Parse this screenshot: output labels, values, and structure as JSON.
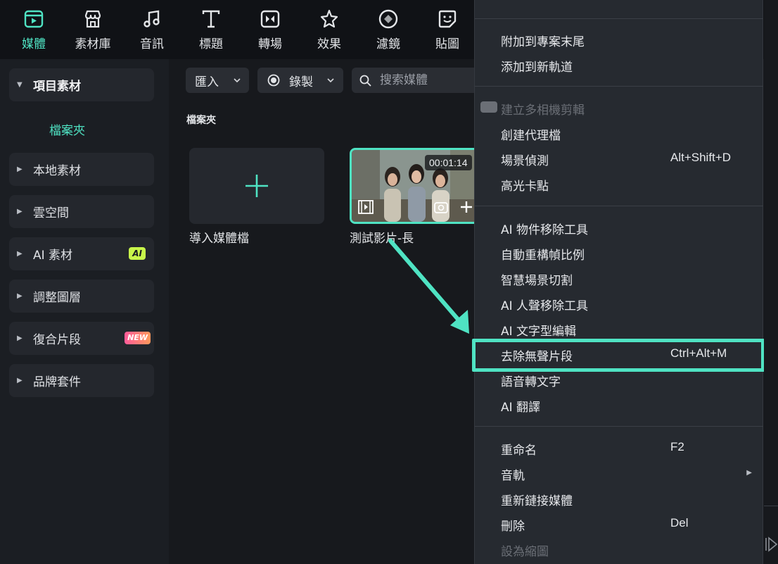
{
  "toolbar": {
    "tabs": [
      {
        "label": "媒體",
        "icon": "media-icon",
        "active": true
      },
      {
        "label": "素材庫",
        "icon": "store-icon"
      },
      {
        "label": "音訊",
        "icon": "music-note-icon"
      },
      {
        "label": "標題",
        "icon": "text-t-icon"
      },
      {
        "label": "轉場",
        "icon": "transition-icon"
      },
      {
        "label": "效果",
        "icon": "effects-star-icon"
      },
      {
        "label": "濾鏡",
        "icon": "filter-icon"
      },
      {
        "label": "貼圖",
        "icon": "sticker-icon"
      }
    ]
  },
  "sidebar": {
    "project_media": "項目素材",
    "folder": "檔案夾",
    "local_media": "本地素材",
    "cloud": "雲空間",
    "ai_media": "AI 素材",
    "ai_badge": "AI",
    "adjustment_layer": "調整圖層",
    "compound_clip": "復合片段",
    "new_badge": "NEW",
    "brand_kit": "品牌套件"
  },
  "media_panel": {
    "import_label": "匯入",
    "record_label": "錄製",
    "search_placeholder": "搜索媒體",
    "section_title": "檔案夾",
    "import_tile_label": "導入媒體檔",
    "video_label": "測試影片-長",
    "video_duration": "00:01:14"
  },
  "context_menu": {
    "append_to_end": "附加到專案末尾",
    "add_to_new_track": "添加到新軌道",
    "multicam": "建立多相機剪輯",
    "create_proxy": "創建代理檔",
    "scene_detection": "場景偵測",
    "scene_detection_shortcut": "Alt+Shift+D",
    "highlight_beat": "高光卡點",
    "ai_object_remover": "AI 物件移除工具",
    "auto_reframe": "自動重構幀比例",
    "smart_scene_cut": "智慧場景切割",
    "ai_vocal_remover": "AI 人聲移除工具",
    "ai_text_edit": "AI 文字型編輯",
    "silence_detection": "去除無聲片段",
    "silence_detection_shortcut": "Ctrl+Alt+M",
    "speech_to_text": "語音轉文字",
    "ai_translate": "AI 翻譯",
    "rename": "重命名",
    "rename_shortcut": "F2",
    "audio_track": "音軌",
    "relink_media": "重新鏈接媒體",
    "delete": "刪除",
    "delete_shortcut": "Del",
    "set_thumbnail": "設為縮圖"
  },
  "colors": {
    "accent": "#4fe3c3",
    "background": "#17191d",
    "menu_bg": "#262a30"
  }
}
